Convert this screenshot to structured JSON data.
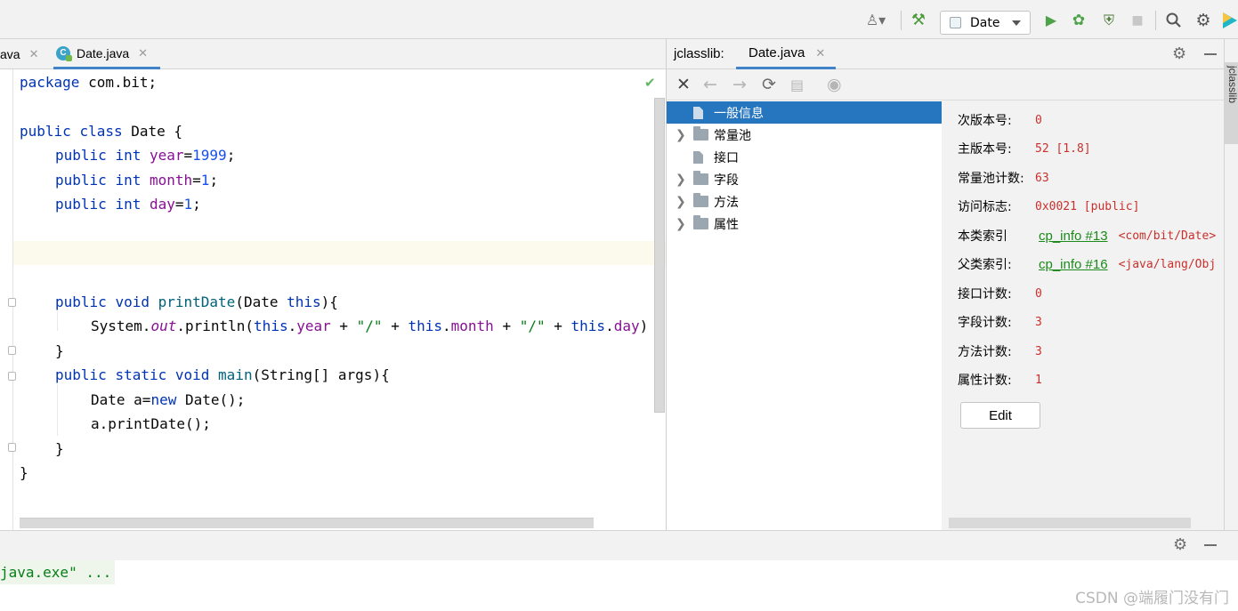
{
  "toolbar": {
    "run_config": "Date",
    "icons": [
      "user-icon",
      "build-hammer-icon",
      "run-icon",
      "debug-icon",
      "coverage-icon",
      "stop-icon",
      "search-icon",
      "settings-icon",
      "jetbrains-icon"
    ]
  },
  "editor": {
    "tabs": [
      {
        "label": "ava",
        "active": false
      },
      {
        "label": "Date.java",
        "active": true
      }
    ],
    "lines": {
      "l1": {
        "kw": "package",
        "rest": " com.bit;"
      },
      "l3": {
        "kw1": "public",
        "kw2": "class",
        "rest": " Date {"
      },
      "field_public": "public",
      "field_int": "int",
      "year": {
        "name": "year",
        "value": "1999"
      },
      "month": {
        "name": "month",
        "value": "1"
      },
      "day": {
        "name": "day",
        "value": "1"
      },
      "void": "void",
      "static": "static",
      "printDate_name": "printDate",
      "printDate_params": "(Date ",
      "this_kw": "this",
      "printDate_end": "){",
      "system": "System.",
      "out": "out",
      "println": ".println(",
      "plus": " + ",
      "slash": "\"/\"",
      "dot": ".",
      "close_brace": "}",
      "main_name": "main",
      "main_params": "(String[] args){",
      "date_decl": "Date a=",
      "new_kw": "new",
      "date_ctor": " Date();",
      "call": "a.printDate();"
    }
  },
  "jclasslib": {
    "title": "jclasslib:",
    "tab": "Date.java",
    "tree": [
      {
        "label": "一般信息",
        "selected": true,
        "expandable": false,
        "icon": "file"
      },
      {
        "label": "常量池",
        "selected": false,
        "expandable": true,
        "icon": "folder"
      },
      {
        "label": "接口",
        "selected": false,
        "expandable": false,
        "icon": "file"
      },
      {
        "label": "字段",
        "selected": false,
        "expandable": true,
        "icon": "folder"
      },
      {
        "label": "方法",
        "selected": false,
        "expandable": true,
        "icon": "folder"
      },
      {
        "label": "属性",
        "selected": false,
        "expandable": true,
        "icon": "folder"
      }
    ],
    "info": {
      "minor": {
        "label": "次版本号:",
        "value": "0"
      },
      "major": {
        "label": "主版本号:",
        "value": "52 [1.8]"
      },
      "cp_count": {
        "label": "常量池计数:",
        "value": "63"
      },
      "access": {
        "label": "访问标志:",
        "value": "0x0021 [public]"
      },
      "this_class": {
        "label": "本类索引",
        "link": "cp_info #13",
        "value": "<com/bit/Date>"
      },
      "super_class": {
        "label": "父类索引:",
        "link": "cp_info #16",
        "value": "<java/lang/Obj"
      },
      "iface_count": {
        "label": "接口计数:",
        "value": "0"
      },
      "field_count": {
        "label": "字段计数:",
        "value": "3"
      },
      "method_count": {
        "label": "方法计数:",
        "value": "3"
      },
      "attr_count": {
        "label": "属性计数:",
        "value": "1"
      }
    },
    "edit_label": "Edit",
    "side_label": "jclasslib"
  },
  "console": {
    "line": "java.exe\" ..."
  },
  "watermark": "CSDN @端履门没有门"
}
